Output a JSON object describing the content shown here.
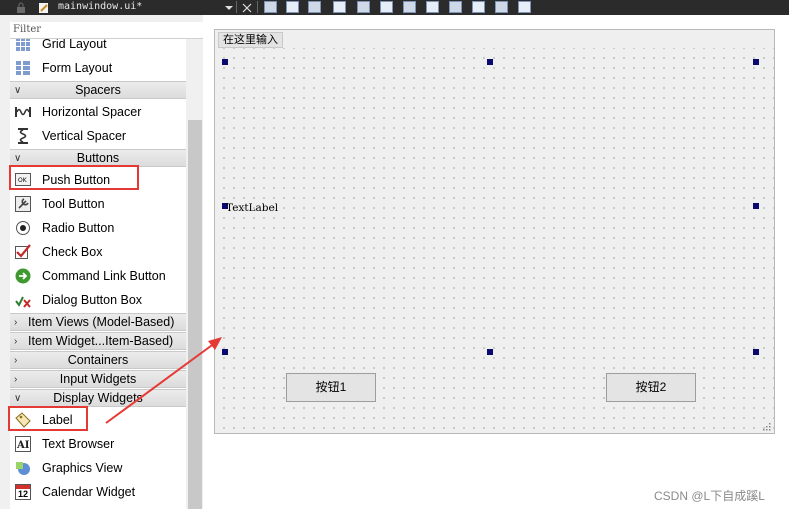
{
  "toolbar": {
    "document_title": "mainwindow.ui*",
    "icons": [
      "lock-icon",
      "edit-icon",
      "dropdown-icon",
      "close-icon",
      "edit-widgets-icon",
      "edit-signals-icon",
      "edit-buddies-icon",
      "edit-tab-order-icon",
      "layout-horizontal-icon",
      "layout-vertical-icon",
      "layout-h-splitter-icon",
      "layout-v-splitter-icon",
      "layout-grid-icon",
      "layout-form-icon",
      "break-layout-icon",
      "adjust-size-icon"
    ]
  },
  "widget_box": {
    "filter_placeholder": "Filter",
    "items": {
      "grid_layout": "Grid Layout",
      "form_layout": "Form Layout",
      "spacers": "Spacers",
      "horizontal_spacer": "Horizontal Spacer",
      "vertical_spacer": "Vertical Spacer",
      "buttons": "Buttons",
      "push_button": "Push Button",
      "tool_button": "Tool Button",
      "radio_button": "Radio Button",
      "check_box": "Check Box",
      "command_link_button": "Command Link Button",
      "dialog_button_box": "Dialog Button Box",
      "item_views": "Item Views (Model-Based)",
      "item_widgets": "Item Widget...Item-Based)",
      "containers": "Containers",
      "input_widgets": "Input Widgets",
      "display_widgets": "Display Widgets",
      "label": "Label",
      "text_browser": "Text Browser",
      "graphics_view": "Graphics View",
      "calendar_widget": "Calendar Widget",
      "calendar_day": "12"
    }
  },
  "form": {
    "menu_placeholder": "在这里输入",
    "text_label": "TextLabel",
    "button1": "按钮1",
    "button2": "按钮2"
  },
  "watermark": "CSDN @L下自成蹊L",
  "colors": {
    "highlight": "#e53935",
    "handle": "#0a0a6e"
  }
}
